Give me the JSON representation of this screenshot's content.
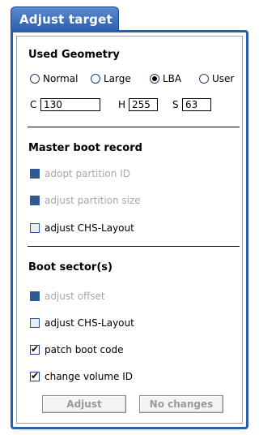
{
  "tab": {
    "title": "Adjust target"
  },
  "geometry": {
    "heading": "Used Geometry",
    "options": [
      {
        "label": "Normal",
        "selected": false
      },
      {
        "label": "Large",
        "selected": false
      },
      {
        "label": "LBA",
        "selected": true
      },
      {
        "label": "User",
        "selected": false
      }
    ],
    "c_label": "C",
    "c_value": "130",
    "h_label": "H",
    "h_value": "255",
    "s_label": "S",
    "s_value": "63"
  },
  "mbr": {
    "heading": "Master boot record",
    "items": [
      {
        "label": "adopt partition ID",
        "enabled": false,
        "checked": false
      },
      {
        "label": "adjust partition size",
        "enabled": false,
        "checked": false
      },
      {
        "label": "adjust CHS-Layout",
        "enabled": true,
        "checked": false
      }
    ]
  },
  "boot": {
    "heading": "Boot sector(s)",
    "items": [
      {
        "label": "adjust offset",
        "enabled": false,
        "checked": false
      },
      {
        "label": "adjust CHS-Layout",
        "enabled": true,
        "checked": false
      },
      {
        "label": "patch boot code",
        "enabled": true,
        "checked": true
      },
      {
        "label": "change volume ID",
        "enabled": true,
        "checked": true
      }
    ]
  },
  "buttons": {
    "adjust": "Adjust",
    "no_changes": "No changes"
  }
}
